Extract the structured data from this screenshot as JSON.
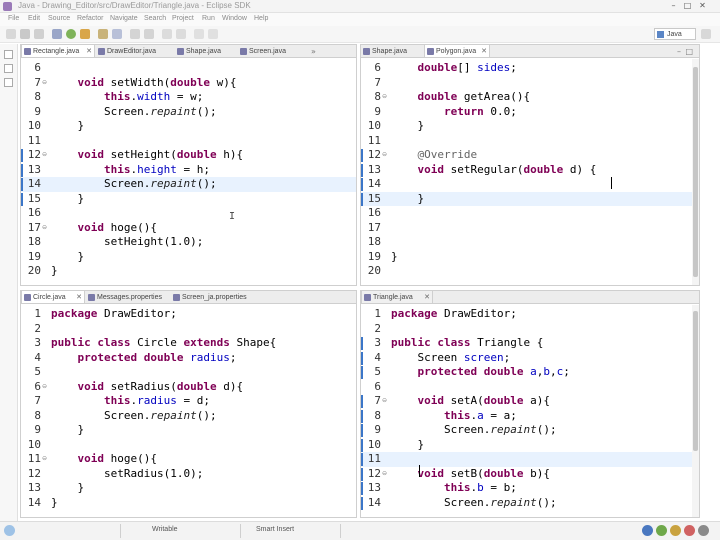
{
  "window": {
    "title": "Java - Drawing_Editor/src/DrawEditor/Triangle.java - Eclipse SDK",
    "min": "–",
    "max": "□",
    "close": "✕"
  },
  "menu": [
    "File",
    "Edit",
    "Source",
    "Refactor",
    "Navigate",
    "Search",
    "Project",
    "Run",
    "Window",
    "Help"
  ],
  "perspective": "Java",
  "colors": {
    "keyword": "#7f0055",
    "field": "#0000c0",
    "annotation": "#646464",
    "marker": "#3b76c8",
    "line_highlight": "#e8f2fe"
  },
  "panes": {
    "top_left": {
      "tabs": [
        {
          "label": "Rectangle.java",
          "close": "✕"
        },
        {
          "label": "DrawEditor.java",
          "close": ""
        },
        {
          "label": "Shape.java",
          "close": ""
        },
        {
          "label": "Screen.java",
          "close": ""
        }
      ],
      "overflow": "»",
      "lines": [
        {
          "num": "6",
          "fold": "",
          "marker": false,
          "tokens": []
        },
        {
          "num": "7",
          "fold": "⊖",
          "marker": false,
          "tokens": [
            [
              "    ",
              ""
            ],
            [
              "void",
              "kw"
            ],
            [
              " setWidth(",
              ""
            ],
            [
              "double",
              "kw"
            ],
            [
              " w){",
              ""
            ]
          ]
        },
        {
          "num": "8",
          "fold": "",
          "marker": false,
          "tokens": [
            [
              "        ",
              ""
            ],
            [
              "this",
              "kw"
            ],
            [
              ".",
              ""
            ],
            [
              "width",
              "fld"
            ],
            [
              " = w;",
              ""
            ]
          ]
        },
        {
          "num": "9",
          "fold": "",
          "marker": false,
          "tokens": [
            [
              "        Screen.",
              ""
            ],
            [
              "repaint",
              "ital"
            ],
            [
              "();",
              ""
            ]
          ]
        },
        {
          "num": "10",
          "fold": "",
          "marker": false,
          "tokens": [
            [
              "    }",
              ""
            ]
          ]
        },
        {
          "num": "11",
          "fold": "",
          "marker": false,
          "tokens": []
        },
        {
          "num": "12",
          "fold": "⊖",
          "marker": true,
          "tokens": [
            [
              "    ",
              ""
            ],
            [
              "void",
              "kw"
            ],
            [
              " setHeight(",
              ""
            ],
            [
              "double",
              "kw"
            ],
            [
              " h){",
              ""
            ]
          ]
        },
        {
          "num": "13",
          "fold": "",
          "marker": true,
          "tokens": [
            [
              "        ",
              ""
            ],
            [
              "this",
              "kw"
            ],
            [
              ".",
              ""
            ],
            [
              "height",
              "fld"
            ],
            [
              " = h;",
              ""
            ]
          ]
        },
        {
          "num": "14",
          "fold": "",
          "marker": true,
          "hl": true,
          "tokens": [
            [
              "        Screen.",
              ""
            ],
            [
              "repaint",
              "ital"
            ],
            [
              "();",
              ""
            ]
          ]
        },
        {
          "num": "15",
          "fold": "",
          "marker": true,
          "tokens": [
            [
              "    }",
              ""
            ]
          ]
        },
        {
          "num": "16",
          "fold": "",
          "marker": false,
          "tokens": []
        },
        {
          "num": "17",
          "fold": "⊖",
          "marker": false,
          "tokens": [
            [
              "    ",
              ""
            ],
            [
              "void",
              "kw"
            ],
            [
              " hoge(){",
              ""
            ]
          ]
        },
        {
          "num": "18",
          "fold": "",
          "marker": false,
          "tokens": [
            [
              "        setHeight(1.0);",
              ""
            ]
          ]
        },
        {
          "num": "19",
          "fold": "",
          "marker": false,
          "tokens": [
            [
              "    }",
              ""
            ]
          ]
        },
        {
          "num": "20",
          "fold": "",
          "marker": false,
          "tokens": [
            [
              "}",
              ""
            ]
          ]
        }
      ]
    },
    "top_right": {
      "tabs": [
        {
          "label": "Shape.java",
          "close": ""
        },
        {
          "label": "Polygon.java",
          "close": "✕"
        }
      ],
      "ctrl_min": "–",
      "ctrl_max": "□",
      "lines": [
        {
          "num": "6",
          "fold": "",
          "marker": false,
          "tokens": [
            [
              "    ",
              ""
            ],
            [
              "double",
              "kw"
            ],
            [
              "[] ",
              ""
            ],
            [
              "sides",
              "fld"
            ],
            [
              ";",
              ""
            ]
          ]
        },
        {
          "num": "7",
          "fold": "",
          "marker": false,
          "tokens": []
        },
        {
          "num": "8",
          "fold": "⊖",
          "marker": false,
          "tokens": [
            [
              "    ",
              ""
            ],
            [
              "double",
              "kw"
            ],
            [
              " getArea(){",
              ""
            ]
          ]
        },
        {
          "num": "9",
          "fold": "",
          "marker": false,
          "tokens": [
            [
              "        ",
              ""
            ],
            [
              "return",
              "kw"
            ],
            [
              " 0.0;",
              ""
            ]
          ]
        },
        {
          "num": "10",
          "fold": "",
          "marker": false,
          "tokens": [
            [
              "    }",
              ""
            ]
          ]
        },
        {
          "num": "11",
          "fold": "",
          "marker": false,
          "tokens": []
        },
        {
          "num": "12",
          "fold": "⊖",
          "marker": true,
          "tokens": [
            [
              "    ",
              ""
            ],
            [
              "@Override",
              "ann"
            ]
          ]
        },
        {
          "num": "13",
          "fold": "",
          "marker": true,
          "tokens": [
            [
              "    ",
              ""
            ],
            [
              "void",
              "kw"
            ],
            [
              " setRegular(",
              ""
            ],
            [
              "double",
              "kw"
            ],
            [
              " d) {",
              ""
            ]
          ]
        },
        {
          "num": "14",
          "fold": "",
          "marker": true,
          "tokens": []
        },
        {
          "num": "15",
          "fold": "",
          "marker": true,
          "hl": true,
          "tokens": [
            [
              "    }",
              ""
            ]
          ]
        },
        {
          "num": "16",
          "fold": "",
          "marker": false,
          "tokens": []
        },
        {
          "num": "17",
          "fold": "",
          "marker": false,
          "tokens": []
        },
        {
          "num": "18",
          "fold": "",
          "marker": false,
          "tokens": []
        },
        {
          "num": "19",
          "fold": "",
          "marker": false,
          "tokens": [
            [
              "}",
              ""
            ]
          ]
        },
        {
          "num": "20",
          "fold": "",
          "marker": false,
          "tokens": []
        }
      ]
    },
    "bottom_left": {
      "tabs": [
        {
          "label": "Circle.java",
          "close": "✕"
        },
        {
          "label": "Messages.properties",
          "close": ""
        },
        {
          "label": "Screen_ja.properties",
          "close": ""
        }
      ],
      "lines": [
        {
          "num": "1",
          "fold": "",
          "marker": false,
          "tokens": [
            [
              "package",
              "kw"
            ],
            [
              " DrawEditor;",
              ""
            ]
          ]
        },
        {
          "num": "2",
          "fold": "",
          "marker": false,
          "tokens": []
        },
        {
          "num": "3",
          "fold": "",
          "marker": false,
          "tokens": [
            [
              "public",
              "kw"
            ],
            [
              " ",
              ""
            ],
            [
              "class",
              "kw"
            ],
            [
              " Circle ",
              ""
            ],
            [
              "extends",
              "kw"
            ],
            [
              " Shape{",
              ""
            ]
          ]
        },
        {
          "num": "4",
          "fold": "",
          "marker": false,
          "tokens": [
            [
              "    ",
              ""
            ],
            [
              "protected",
              "kw"
            ],
            [
              " ",
              ""
            ],
            [
              "double",
              "kw"
            ],
            [
              " ",
              ""
            ],
            [
              "radius",
              "fld"
            ],
            [
              ";",
              ""
            ]
          ]
        },
        {
          "num": "5",
          "fold": "",
          "marker": false,
          "tokens": []
        },
        {
          "num": "6",
          "fold": "⊖",
          "marker": false,
          "tokens": [
            [
              "    ",
              ""
            ],
            [
              "void",
              "kw"
            ],
            [
              " setRadius(",
              ""
            ],
            [
              "double",
              "kw"
            ],
            [
              " d){",
              ""
            ]
          ]
        },
        {
          "num": "7",
          "fold": "",
          "marker": false,
          "tokens": [
            [
              "        ",
              ""
            ],
            [
              "this",
              "kw"
            ],
            [
              ".",
              ""
            ],
            [
              "radius",
              "fld"
            ],
            [
              " = d;",
              ""
            ]
          ]
        },
        {
          "num": "8",
          "fold": "",
          "marker": false,
          "tokens": [
            [
              "        Screen.",
              ""
            ],
            [
              "repaint",
              "ital"
            ],
            [
              "();",
              ""
            ]
          ]
        },
        {
          "num": "9",
          "fold": "",
          "marker": false,
          "tokens": [
            [
              "    }",
              ""
            ]
          ]
        },
        {
          "num": "10",
          "fold": "",
          "marker": false,
          "tokens": []
        },
        {
          "num": "11",
          "fold": "⊖",
          "marker": false,
          "tokens": [
            [
              "    ",
              ""
            ],
            [
              "void",
              "kw"
            ],
            [
              " hoge(){",
              ""
            ]
          ]
        },
        {
          "num": "12",
          "fold": "",
          "marker": false,
          "tokens": [
            [
              "        setRadius(1.0);",
              ""
            ]
          ]
        },
        {
          "num": "13",
          "fold": "",
          "marker": false,
          "tokens": [
            [
              "    }",
              ""
            ]
          ]
        },
        {
          "num": "14",
          "fold": "",
          "marker": false,
          "tokens": [
            [
              "}",
              ""
            ]
          ]
        }
      ]
    },
    "bottom_right": {
      "tabs": [
        {
          "label": "Triangle.java",
          "close": "✕"
        }
      ],
      "lines": [
        {
          "num": "1",
          "fold": "",
          "marker": false,
          "tokens": [
            [
              "package",
              "kw"
            ],
            [
              " DrawEditor;",
              ""
            ]
          ]
        },
        {
          "num": "2",
          "fold": "",
          "marker": false,
          "tokens": []
        },
        {
          "num": "3",
          "fold": "",
          "marker": true,
          "tokens": [
            [
              "public",
              "kw"
            ],
            [
              " ",
              ""
            ],
            [
              "class",
              "kw"
            ],
            [
              " Triangle {",
              ""
            ]
          ]
        },
        {
          "num": "4",
          "fold": "",
          "marker": true,
          "tokens": [
            [
              "    Screen ",
              ""
            ],
            [
              "screen",
              "fld"
            ],
            [
              ";",
              ""
            ]
          ]
        },
        {
          "num": "5",
          "fold": "",
          "marker": true,
          "tokens": [
            [
              "    ",
              ""
            ],
            [
              "protected",
              "kw"
            ],
            [
              " ",
              ""
            ],
            [
              "double",
              "kw"
            ],
            [
              " ",
              ""
            ],
            [
              "a",
              "fld"
            ],
            [
              ",",
              ""
            ],
            [
              "b",
              "fld"
            ],
            [
              ",",
              ""
            ],
            [
              "c",
              "fld"
            ],
            [
              ";",
              ""
            ]
          ]
        },
        {
          "num": "6",
          "fold": "",
          "marker": false,
          "tokens": []
        },
        {
          "num": "7",
          "fold": "⊖",
          "marker": true,
          "tokens": [
            [
              "    ",
              ""
            ],
            [
              "void",
              "kw"
            ],
            [
              " setA(",
              ""
            ],
            [
              "double",
              "kw"
            ],
            [
              " a){",
              ""
            ]
          ]
        },
        {
          "num": "8",
          "fold": "",
          "marker": true,
          "tokens": [
            [
              "        ",
              ""
            ],
            [
              "this",
              "kw"
            ],
            [
              ".",
              ""
            ],
            [
              "a",
              "fld"
            ],
            [
              " = a;",
              ""
            ]
          ]
        },
        {
          "num": "9",
          "fold": "",
          "marker": true,
          "tokens": [
            [
              "        Screen.",
              ""
            ],
            [
              "repaint",
              "ital"
            ],
            [
              "();",
              ""
            ]
          ]
        },
        {
          "num": "10",
          "fold": "",
          "marker": true,
          "tokens": [
            [
              "    }",
              ""
            ]
          ]
        },
        {
          "num": "11",
          "fold": "",
          "marker": true,
          "hl": true,
          "tokens": []
        },
        {
          "num": "12",
          "fold": "⊖",
          "marker": true,
          "tokens": [
            [
              "    ",
              ""
            ],
            [
              "void",
              "kw"
            ],
            [
              " setB(",
              ""
            ],
            [
              "double",
              "kw"
            ],
            [
              " b){",
              ""
            ]
          ]
        },
        {
          "num": "13",
          "fold": "",
          "marker": true,
          "tokens": [
            [
              "        ",
              ""
            ],
            [
              "this",
              "kw"
            ],
            [
              ".",
              ""
            ],
            [
              "b",
              "fld"
            ],
            [
              " = b;",
              ""
            ]
          ]
        },
        {
          "num": "14",
          "fold": "",
          "marker": true,
          "tokens": [
            [
              "        Screen.",
              ""
            ],
            [
              "repaint",
              "ital"
            ],
            [
              "();",
              ""
            ]
          ]
        }
      ]
    }
  },
  "status": {
    "writable": "Writable",
    "insert_mode": "Smart Insert"
  }
}
